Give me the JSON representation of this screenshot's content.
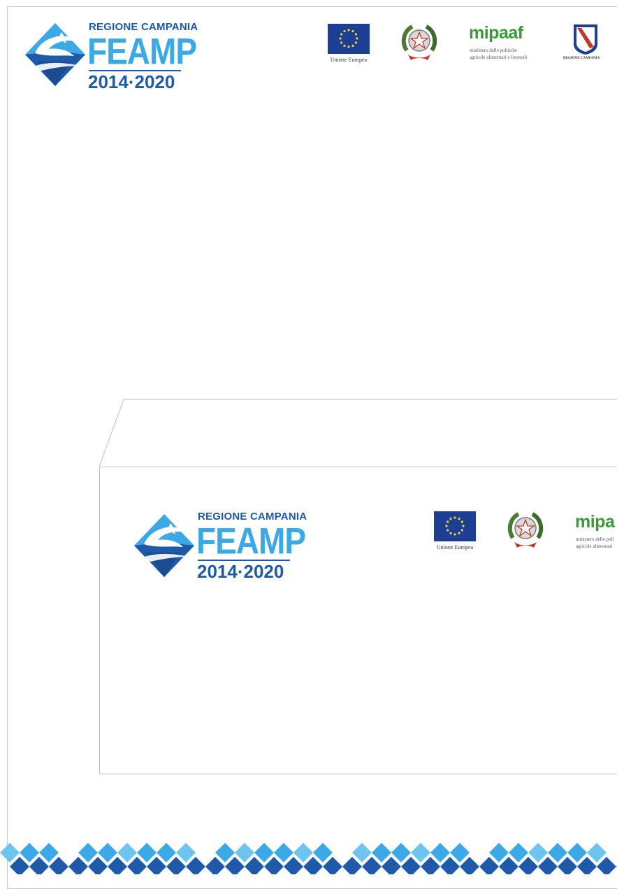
{
  "letterhead": {
    "feamp_logo": {
      "region": "REGIONE CAMPANIA",
      "word": "FEAMP",
      "years": "2014·2020",
      "emblem_icon": "feamp-fish-emblem-icon"
    },
    "partners": {
      "eu": {
        "caption": "Unione Europea",
        "icon": "eu-flag-icon"
      },
      "italy": {
        "icon": "italian-republic-emblem-icon"
      },
      "mipaaf": {
        "word": "mipaaf",
        "line1": "ministero delle politiche",
        "line2": "agricole alimentari e forestali"
      },
      "campania": {
        "caption": "REGIONE CAMPANIA",
        "icon": "regione-campania-crest-icon"
      }
    }
  },
  "envelope": {
    "feamp_logo": {
      "region": "REGIONE CAMPANIA",
      "word": "FEAMP",
      "years": "2014·2020"
    },
    "partners": {
      "eu": {
        "caption": "Unione Europea"
      },
      "mipaaf": {
        "word": "mipa",
        "line1": "ministero delle poli",
        "line2": "agricole alimentari"
      }
    }
  },
  "colors": {
    "feamp_dark_blue": "#1e5aa8",
    "feamp_light_blue": "#3aa9e6",
    "eu_blue": "#1c3f94",
    "eu_gold": "#f4d03f",
    "mipaaf_green": "#3a9a3a"
  }
}
